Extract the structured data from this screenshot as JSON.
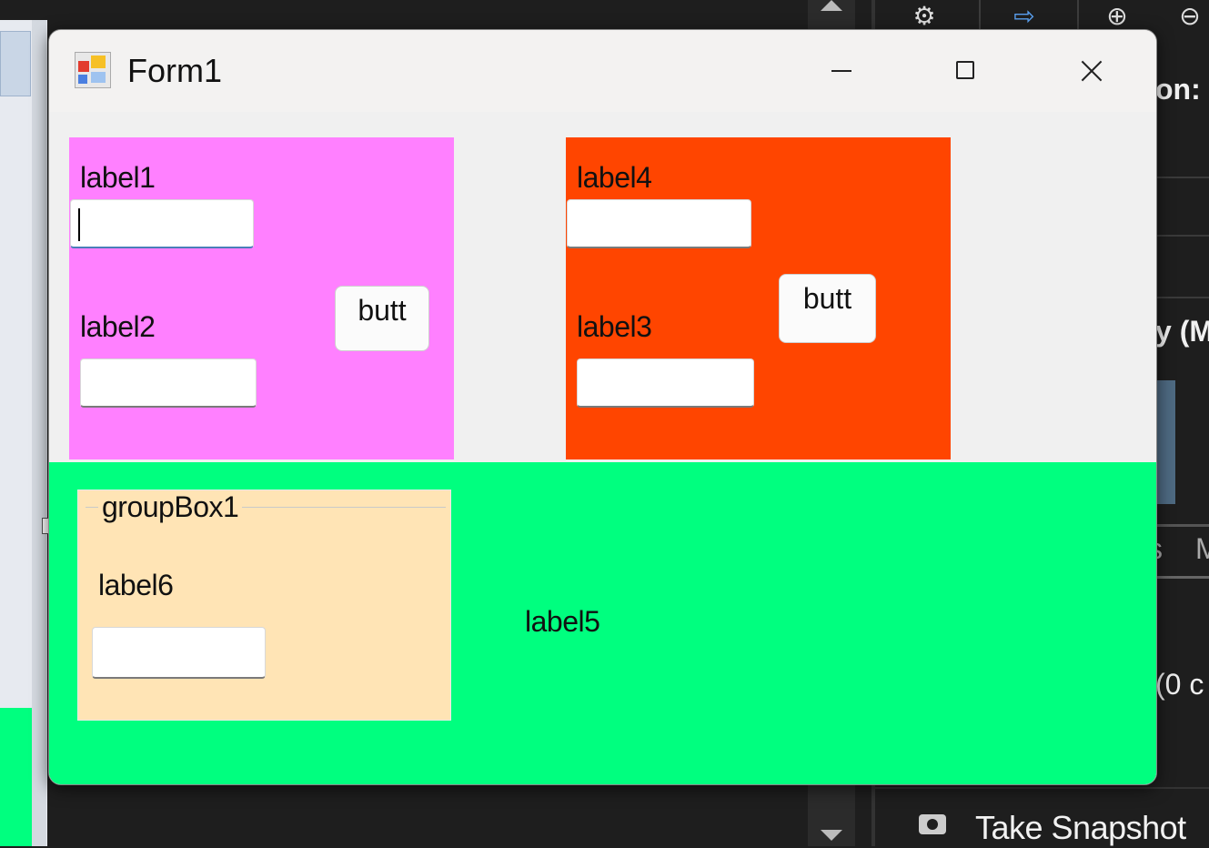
{
  "background": {
    "toolbar_icons": [
      "gear-icon",
      "navigate-arrow-icon",
      "zoom-in-icon",
      "zoom-out-icon"
    ],
    "right_panel_texts": [
      "on:",
      "y (M",
      "s",
      "M",
      "(0 c"
    ],
    "snapshot_label": "Take Snapshot"
  },
  "window": {
    "title": "Form1",
    "controls": [
      "minimize",
      "maximize",
      "close"
    ]
  },
  "panel1": {
    "color": "#ff80ff",
    "label1": "label1",
    "textbox1_value": "",
    "label2": "label2",
    "textbox2_value": "",
    "button": "butt"
  },
  "panel2": {
    "color": "#ff4500",
    "label4": "label4",
    "textbox4_value": "",
    "label3": "label3",
    "textbox3_value": "",
    "button": "butt"
  },
  "panel3": {
    "color": "#00ff7f",
    "groupbox_title": "groupBox1",
    "groupbox_color": "#ffe4b5",
    "label6": "label6",
    "textbox6_value": "",
    "label5": "label5"
  }
}
